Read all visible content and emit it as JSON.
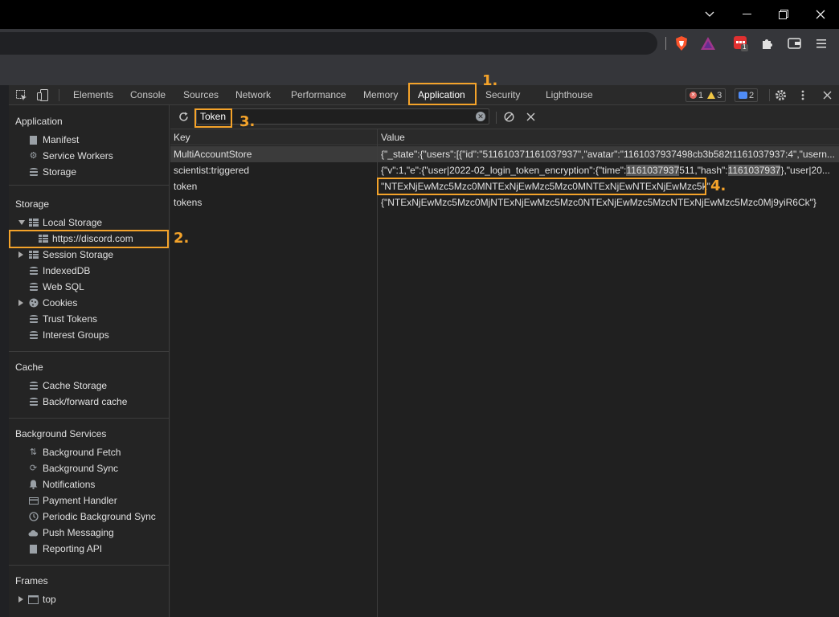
{
  "window": {
    "controls": {
      "minimize": "⌵",
      "restore": "❐",
      "close": "✕"
    }
  },
  "toolbar": {
    "icons": [
      "brave-shield-icon",
      "brave-rewards-icon",
      "extension-badge-icon",
      "puzzle-icon",
      "wallet-icon",
      "menu-icon"
    ],
    "extension_badge_count": "1"
  },
  "devtools": {
    "tabs": [
      "Elements",
      "Console",
      "Sources",
      "Network",
      "Performance",
      "Memory",
      "Application",
      "Security",
      "Lighthouse"
    ],
    "active_tab": "Application",
    "errors": "1",
    "warnings": "3",
    "messages": "2"
  },
  "sidebar": {
    "application": {
      "title": "Application",
      "items": [
        "Manifest",
        "Service Workers",
        "Storage"
      ]
    },
    "storage": {
      "title": "Storage",
      "local_storage": "Local Storage",
      "local_storage_origin": "https://discord.com",
      "items": [
        "Session Storage",
        "IndexedDB",
        "Web SQL",
        "Cookies",
        "Trust Tokens",
        "Interest Groups"
      ]
    },
    "cache": {
      "title": "Cache",
      "items": [
        "Cache Storage",
        "Back/forward cache"
      ]
    },
    "background_services": {
      "title": "Background Services",
      "items": [
        "Background Fetch",
        "Background Sync",
        "Notifications",
        "Payment Handler",
        "Periodic Background Sync",
        "Push Messaging",
        "Reporting API"
      ]
    },
    "frames": {
      "title": "Frames",
      "items": [
        "top"
      ]
    }
  },
  "filter": {
    "value": "Token"
  },
  "table": {
    "headers": [
      "Key",
      "Value"
    ],
    "rows": [
      {
        "key": "MultiAccountStore",
        "value_parts": [
          "{\"_state\":{\"users\":[{\"id\":\"511610371161037937\",\"avatar\":\"1161037937498cb3b582t1161037937:4\",\"usern..."
        ]
      },
      {
        "key": "scientist:triggered",
        "value_parts": [
          "{\"v\":1,\"e\":{\"user|2022-02_login_token_encryption\":{\"time\":",
          "1161037937",
          "511,\"hash\":",
          "1161037937",
          "},\"user|20..."
        ]
      },
      {
        "key": "token",
        "value_parts": [
          "\"NTExNjEwMzc5Mzc0MNTExNjEwMzc5Mzc0MNTExNjEwNTExNjEwMzc5k\""
        ]
      },
      {
        "key": "tokens",
        "value_parts": [
          "{\"NTExNjEwMzc5Mzc0MjNTExNjEwMzc5Mzc0NTExNjEwMzc5MzcNTExNjEwMzc5Mzc0Mj9yiR6Ck\"}"
        ]
      }
    ]
  },
  "annotations": [
    "1.",
    "2.",
    "3.",
    "4."
  ],
  "colors": {
    "annotation": "#f4a32a",
    "accent": "#4f8cf7"
  }
}
